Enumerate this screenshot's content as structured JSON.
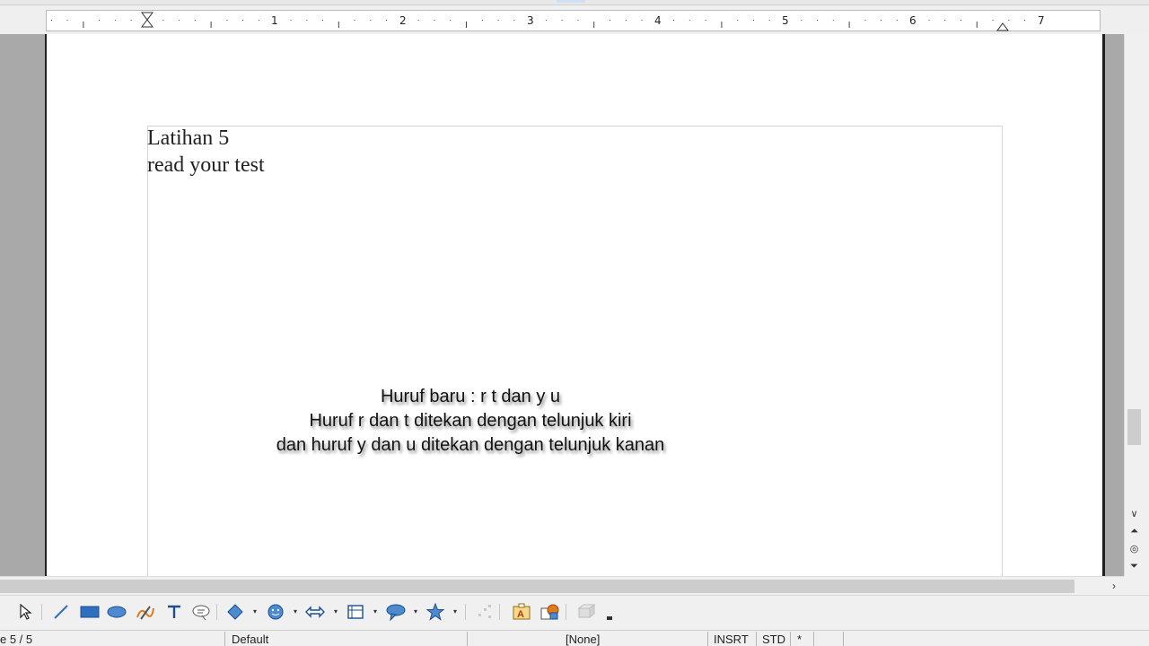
{
  "ruler": {
    "numbers": [
      "1",
      "2",
      "3",
      "4",
      "5",
      "6",
      "7"
    ]
  },
  "document": {
    "lines": [
      "Latihan 5",
      "read your test"
    ],
    "shadow_text": [
      "Huruf baru : r t dan y u",
      "Huruf r dan t ditekan dengan telunjuk kiri",
      "dan huruf y dan u ditekan dengan telunjuk kanan"
    ]
  },
  "scrollbars": {
    "vertical_down": "∨",
    "nav_prev": "⏶",
    "nav_object": "◎",
    "nav_next": "⏷",
    "horizontal_right": "›"
  },
  "drawing_toolbar": {
    "tools": [
      "select-icon",
      "line-icon",
      "rectangle-icon",
      "ellipse-icon",
      "freeform-icon",
      "text-icon",
      "callout-icon",
      "basic-shapes-icon",
      "symbol-shapes-icon",
      "block-arrows-icon",
      "flowchart-icon",
      "callouts-icon",
      "stars-icon",
      "points-icon",
      "fontwork-icon",
      "from-file-icon",
      "extrusion-icon"
    ],
    "dropdown_glyph": "▾"
  },
  "statusbar": {
    "page": "e 5 / 5",
    "style": "Default",
    "language": "[None]",
    "insert_mode": "INSRT",
    "selection_mode": "STD",
    "modified": "*"
  },
  "colors": {
    "workspace": "#a9a9a9",
    "page": "#ffffff",
    "accent_blue": "#2f6fbe"
  }
}
